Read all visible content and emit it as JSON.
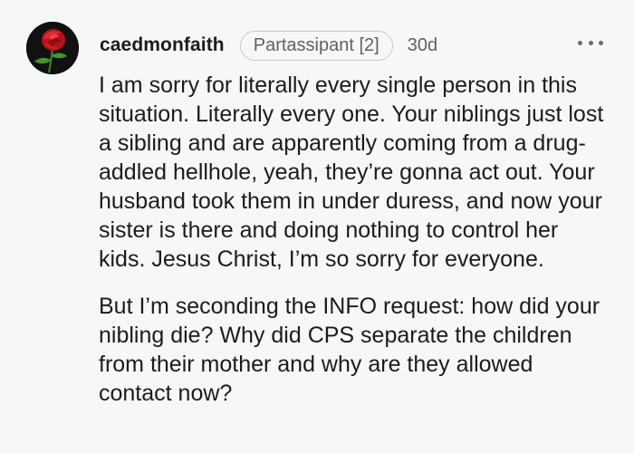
{
  "comment": {
    "author": "caedmonfaith",
    "flair": "Partassipant [2]",
    "age": "30d",
    "avatar_icon": "rose-avatar-icon",
    "more_icon": "more-options-icon",
    "paragraphs": [
      "I am sorry for literally every single person in this situation. Literally every one. Your niblings just lost a sibling and are apparently coming from a drug-addled hellhole, yeah, they’re gonna act out. Your husband took them in under duress, and now your sister is there and doing nothing to control her kids. Jesus Christ, I’m so sorry for everyone.",
      "But I’m seconding the INFO request: how did your nibling die? Why did CPS separate the children from their mother and why are they allowed contact now?"
    ]
  },
  "colors": {
    "background": "#f6f7f8",
    "text": "#1c1c1c",
    "muted": "#5f6265",
    "avatar_bg": "#111111",
    "rose": "#c8141e"
  }
}
